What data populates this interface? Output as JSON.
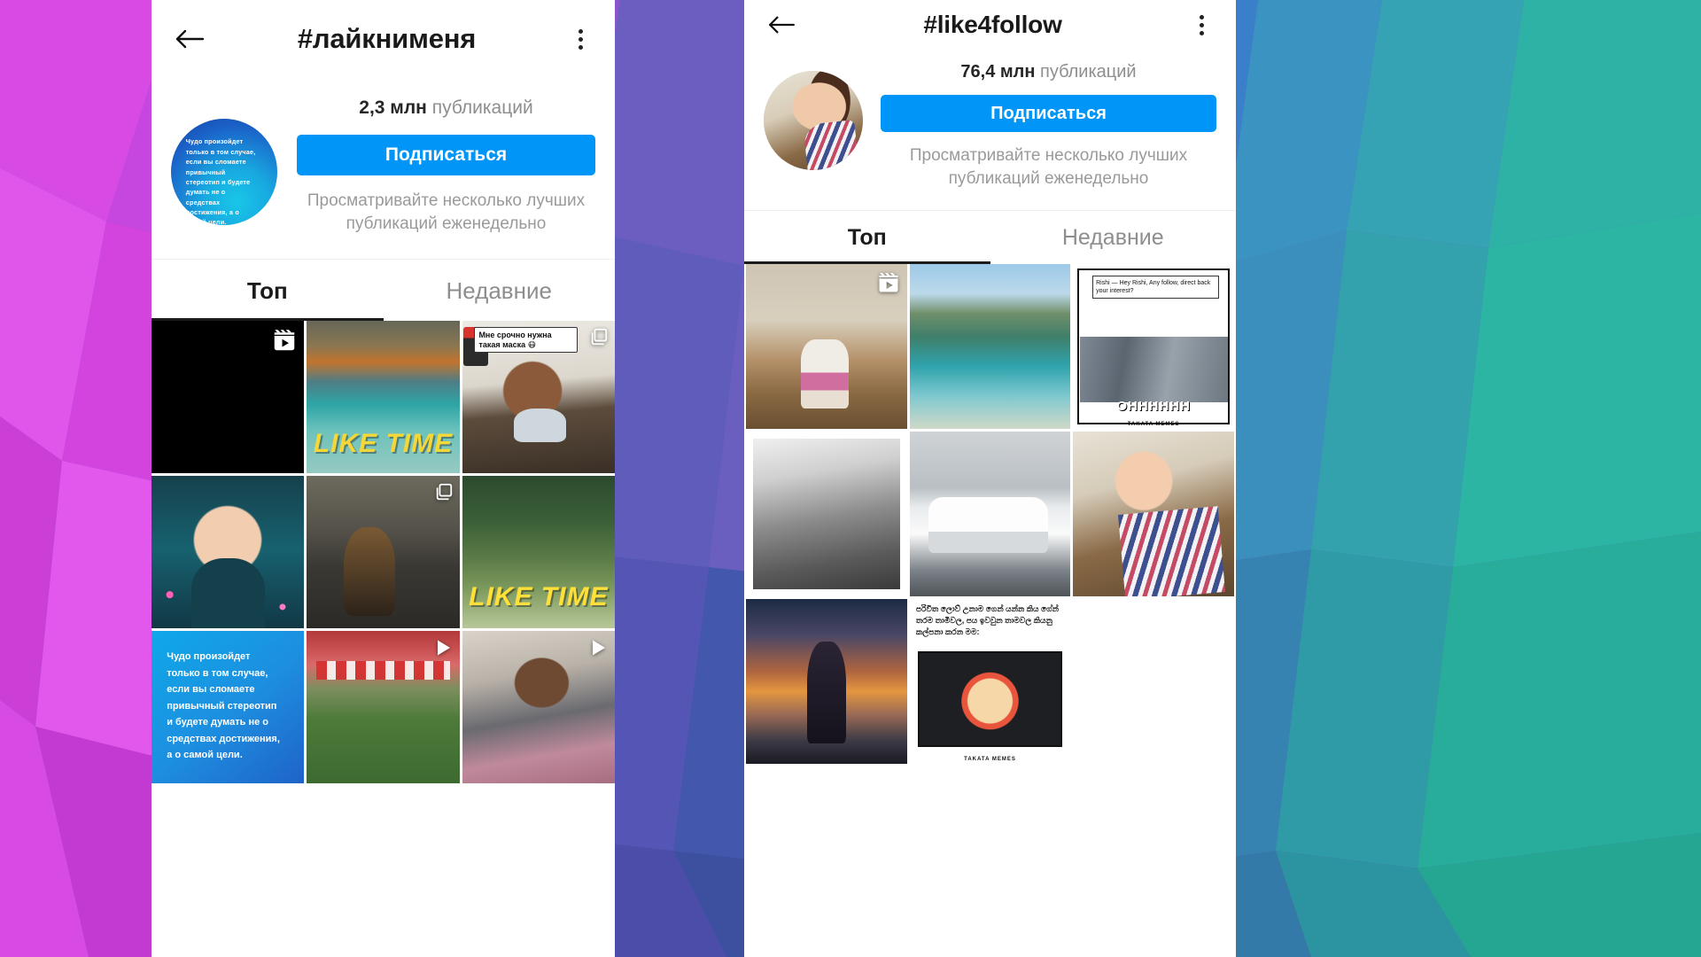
{
  "background": {
    "style": "low-poly-triangles",
    "left_colors": [
      "#e04ae8",
      "#d13ddc",
      "#c85be6",
      "#b84ad8"
    ],
    "middle_colors": [
      "#5b5fb8",
      "#4a63b5",
      "#3f74c0",
      "#6a6fc4",
      "#4f5fae"
    ],
    "right_colors": [
      "#2fb6a8",
      "#35a9a0",
      "#2a9d8f",
      "#46c2b0"
    ]
  },
  "left_phone": {
    "header": {
      "back_icon": "arrow-left-icon",
      "title": "#лайкнименя",
      "menu_icon": "kebab-menu-icon"
    },
    "avatar": {
      "type": "quote-card",
      "text": "Чудо произойдет только в том случае, если вы сломаете привычный стереотип и будете думать не о средствах достижения, а о самой цели."
    },
    "count": {
      "number": "2,3 млн",
      "label": "публикаций"
    },
    "follow_button": "Подписаться",
    "subtitle": "Просматривайте несколько лучших публикаций еженедельно",
    "tabs": [
      {
        "label": "Топ",
        "active": true
      },
      {
        "label": "Недавние",
        "active": false
      }
    ],
    "grid": [
      {
        "name": "tile-reel-dark",
        "art": "a-black",
        "badge": "reel-icon",
        "caption": ""
      },
      {
        "name": "tile-cat-like-time",
        "art": "a-cat",
        "badge": "",
        "caption": "LIKE TIME"
      },
      {
        "name": "tile-mask-meme",
        "art": "a-mask",
        "badge": "carousel-icon",
        "caption": "Мне срочно нужна такая маска 😷"
      },
      {
        "name": "tile-rain-man",
        "art": "a-rain",
        "badge": "",
        "caption": ""
      },
      {
        "name": "tile-dogs",
        "art": "a-dog",
        "badge": "carousel-icon",
        "caption": ""
      },
      {
        "name": "tile-forest-like-time",
        "art": "a-cat2",
        "badge": "",
        "caption": "LIKE TIME"
      },
      {
        "name": "tile-quote-card",
        "art": "a-quote",
        "badge": "",
        "caption": "Чудо произойдет только в том случае, если вы сломаете привычный стереотип и будете думать не о средствах достижения, а о самой цели."
      },
      {
        "name": "tile-stadium-video",
        "art": "a-stad",
        "badge": "play-icon",
        "caption": ""
      },
      {
        "name": "tile-plane-video",
        "art": "a-plane",
        "badge": "play-icon",
        "caption": ""
      }
    ]
  },
  "right_phone": {
    "header": {
      "back_icon": "arrow-left-icon",
      "title": "#like4follow",
      "menu_icon": "kebab-menu-icon"
    },
    "avatar": {
      "type": "photo",
      "alt": "woman-portrait"
    },
    "count": {
      "number": "76,4 млн",
      "label": "публикаций"
    },
    "follow_button": "Подписаться",
    "subtitle": "Просматривайте несколько лучших публикаций еженедельно",
    "tabs": [
      {
        "label": "Топ",
        "active": true
      },
      {
        "label": "Недавние",
        "active": false
      }
    ],
    "grid": [
      {
        "name": "tile-child-room",
        "art": "b-room",
        "badge": "reel-icon",
        "caption": ""
      },
      {
        "name": "tile-sea-beach",
        "art": "b-sea",
        "badge": "",
        "caption": ""
      },
      {
        "name": "tile-ohhhh-meme",
        "art": "b-meme",
        "badge": "",
        "caption": "OHHHHHH",
        "bubble": "Rishi — Hey Rishi, Any follow, direct back your interest?",
        "footer": "TAKATA MEMES"
      },
      {
        "name": "tile-bw-building",
        "art": "b-bw",
        "badge": "",
        "caption": ""
      },
      {
        "name": "tile-white-van",
        "art": "b-van",
        "badge": "",
        "caption": ""
      },
      {
        "name": "tile-girl-plaid",
        "art": "b-girl",
        "badge": "",
        "caption": ""
      },
      {
        "name": "tile-sunset-girl",
        "art": "b-sunset",
        "badge": "",
        "caption": ""
      },
      {
        "name": "tile-sinhala-meme",
        "art": "b-sin",
        "badge": "",
        "caption": "පරිවිත ලොව් උනාම ගෙන් යන්න කිය ගේන් තරම තාමිවල, පය ඉවවුන තාමවල කියනු කල්පනා කරන මම:",
        "footer": "TAKATA MEMES"
      }
    ]
  },
  "colors": {
    "instagram_blue": "#0095f6",
    "text_dark": "#262626",
    "text_muted": "#8e8e8e",
    "like_time_yellow": "#ffe03a"
  }
}
